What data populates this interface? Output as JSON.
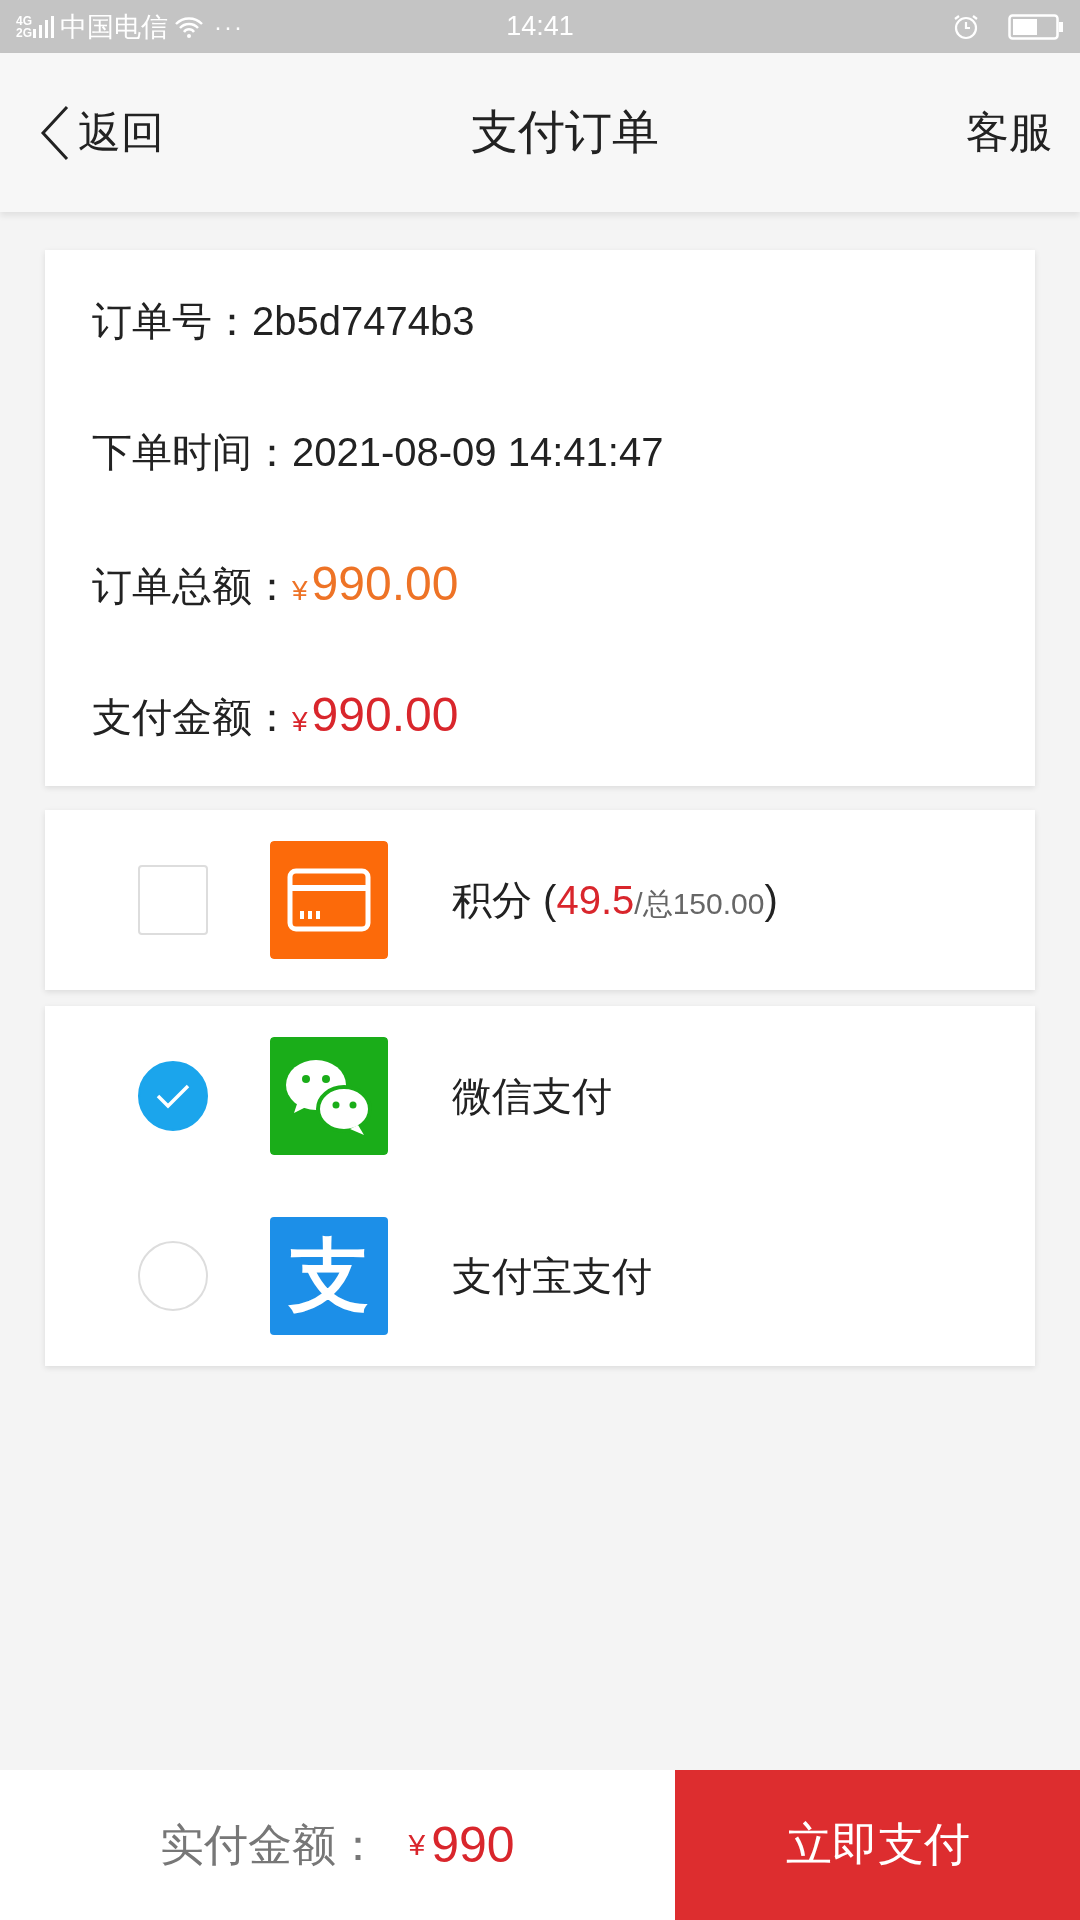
{
  "status_bar": {
    "network_top": "4G",
    "network_bottom": "2G",
    "carrier": "中国电信",
    "more": "···",
    "time": "14:41"
  },
  "nav": {
    "back": "返回",
    "title": "支付订单",
    "service": "客服"
  },
  "order": [
    {
      "label": "订单号：",
      "value": "2b5d7474b3",
      "kind": "plain"
    },
    {
      "label": "下单时间：",
      "value": "2021-08-09 14:41:47",
      "kind": "plain"
    },
    {
      "label": "订单总额：",
      "currency": "¥",
      "value": "990.00",
      "kind": "price",
      "color": "#ee7326"
    },
    {
      "label": "支付金额：",
      "currency": "¥",
      "value": "990.00",
      "kind": "price",
      "color": "#d9262c"
    }
  ],
  "payment_methods": [
    {
      "kind": "points",
      "label": "积分",
      "open": "(",
      "points": "49.5",
      "total": "/总150.00",
      "close": ")",
      "checked": false
    },
    {
      "kind": "wechat",
      "label": "微信支付",
      "selected": true
    },
    {
      "kind": "alipay",
      "logo_text": "支",
      "label": "支付宝支付",
      "selected": false
    }
  ],
  "footer": {
    "label": "实付金额：",
    "currency": "¥",
    "amount": "990",
    "button": "立即支付"
  }
}
